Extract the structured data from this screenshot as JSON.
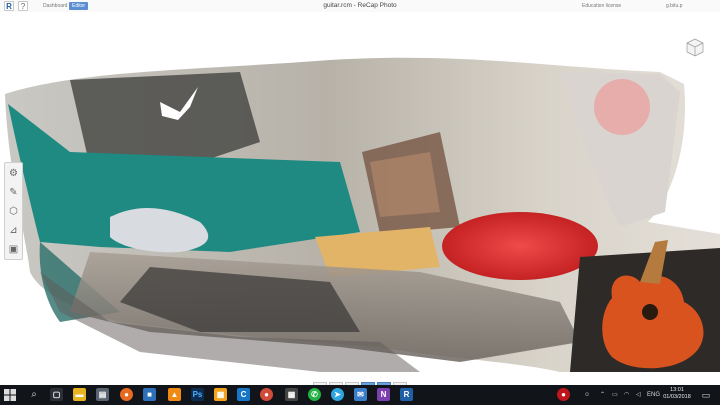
{
  "titlebar": {
    "logo": "R",
    "help": "?",
    "nav_dashboard": "Dashboard",
    "nav_editor": "Editor",
    "title": "guitar.rcm - ReCap Photo",
    "license": "Education license",
    "user": "g.bitu.p"
  },
  "left_tools": [
    "settings-icon",
    "pencil-icon",
    "mesh-icon",
    "measure-icon",
    "export-icon"
  ],
  "bottom_tools": {
    "undo": "↶",
    "redo": "↷",
    "slice": "|||",
    "view": "◈",
    "orbit": "⊕",
    "crop": "⛶"
  },
  "taskbar": {
    "search_icon": "⌕",
    "apps": [
      "task-view",
      "file-explorer",
      "explorer",
      "firefox",
      "store",
      "vlc",
      "photoshop",
      "sketchbook",
      "ccleaner",
      "chrome",
      "calculator",
      "whatsapp",
      "telegram",
      "mail",
      "onenote",
      "recap"
    ],
    "tray": {
      "language": "ENG"
    },
    "time": "13:01",
    "date": "01/03/2018"
  },
  "colors": {
    "accent": "#5b8fd1",
    "taskbar": "#111418",
    "recap_blue": "#1f5fa6"
  }
}
